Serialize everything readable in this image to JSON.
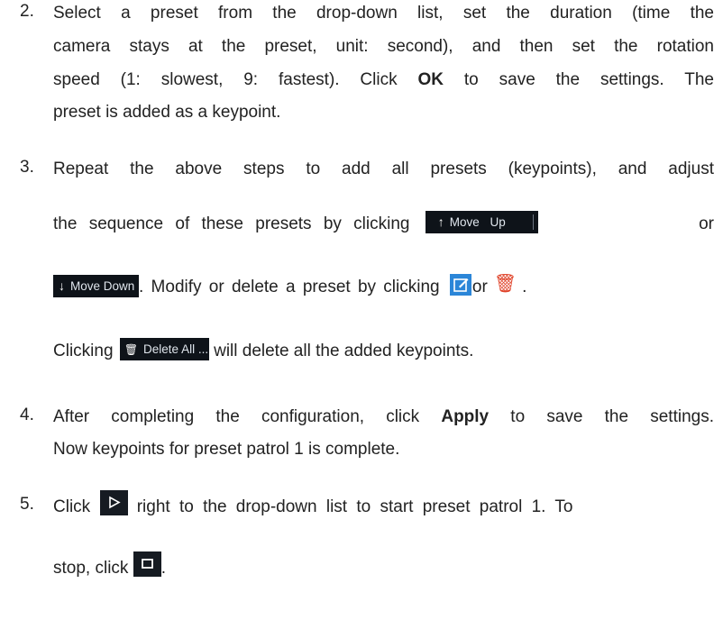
{
  "steps": [
    {
      "number": "2.",
      "lines": [
        "Select a preset from the drop-down list, set the duration (time the",
        "camera stays at the preset, unit: second), and then set the rotation",
        {
          "pre": "speed (1: slowest, 9: fastest). Click ",
          "bold": "OK",
          "post": " to save the settings. The"
        },
        "preset is added as a keypoint."
      ]
    },
    {
      "number": "3.",
      "line1": "Repeat the above steps to add all presets (keypoints), and adjust",
      "line2_text": "the sequence of these presets by clicking",
      "line2_or": "or",
      "line3_text": ". Modify or delete a preset by clicking",
      "line3_or": "or",
      "line3_end": ".",
      "line4_pre": "Clicking",
      "line4_post": "will delete all the added keypoints.",
      "buttons": {
        "move_up": "Move Up",
        "move_down": "Move Down",
        "delete_all": "Delete All ..."
      },
      "icons": {
        "move_up": "arrow-up-icon",
        "move_down": "arrow-down-icon",
        "delete_all": "trash-icon",
        "edit": "edit-icon",
        "delete": "trash-icon"
      }
    },
    {
      "number": "4.",
      "line1_pre": "After completing the configuration, click ",
      "line1_bold": "Apply",
      "line1_post": " to save the settings.",
      "line2": "Now keypoints for preset patrol 1 is complete."
    },
    {
      "number": "5.",
      "line1_pre": "Click",
      "line1_post": "right to the drop-down list to start preset patrol 1. To",
      "line2_pre": "stop, click",
      "line2_post": ".",
      "icons": {
        "play": "play-icon",
        "stop": "stop-icon"
      }
    }
  ],
  "colors": {
    "text": "#222222",
    "button_bg": "#0e1319",
    "edit_icon": "#2b86d8",
    "trash_icon": "#e0442b"
  }
}
